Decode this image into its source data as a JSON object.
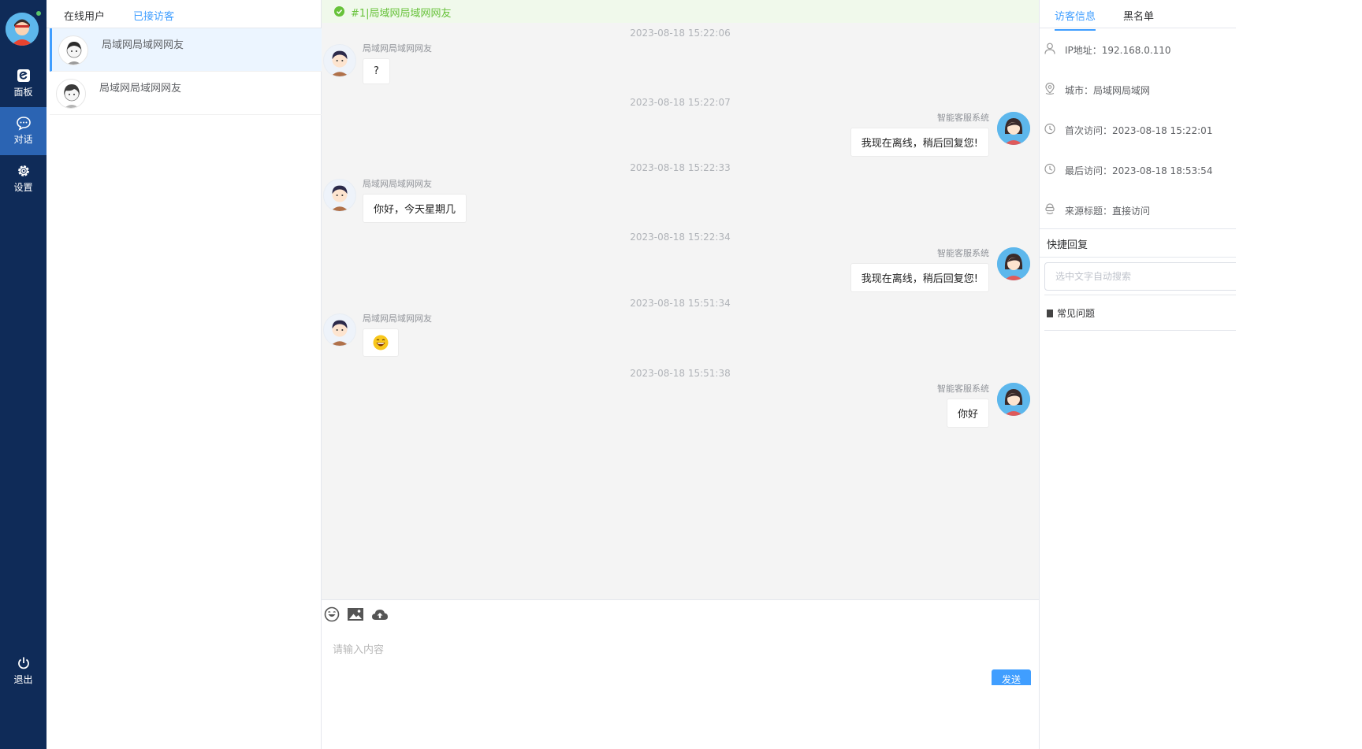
{
  "nav": {
    "items": [
      {
        "label": "面板",
        "icon": "dashboard-icon"
      },
      {
        "label": "对话",
        "icon": "chat-icon"
      },
      {
        "label": "设置",
        "icon": "gear-icon"
      }
    ],
    "logout_label": "退出",
    "active_item": "对话",
    "colors": {
      "background": "#0f2b58",
      "active": "#2b64b3",
      "online": "#5ac66a"
    }
  },
  "visitor_list": {
    "tabs": [
      {
        "label": "在线用户"
      },
      {
        "label": "已接访客"
      }
    ],
    "active_tab": "已接访客",
    "visitors": [
      {
        "name": "局域网局域网网友"
      },
      {
        "name": "局域网局域网网友"
      }
    ]
  },
  "chat": {
    "header_title": "#1|局域网局域网网友",
    "messages": [
      {
        "time": "2023-08-18 15:22:06",
        "side": "visitor",
        "sender": "局域网局域网网友",
        "text": "?"
      },
      {
        "time": "2023-08-18 15:22:07",
        "side": "agent",
        "sender": "智能客服系统",
        "text": "我现在离线，稍后回复您!"
      },
      {
        "time": "2023-08-18 15:22:33",
        "side": "visitor",
        "sender": "局域网局域网网友",
        "text": "你好，今天星期几"
      },
      {
        "time": "2023-08-18 15:22:34",
        "side": "agent",
        "sender": "智能客服系统",
        "text": "我现在离线，稍后回复您!"
      },
      {
        "time": "2023-08-18 15:51:34",
        "side": "visitor",
        "sender": "局域网局域网网友",
        "text": "",
        "emoji": "laughing-emoji"
      },
      {
        "time": "2023-08-18 15:51:38",
        "side": "agent",
        "sender": "智能客服系统",
        "text": "你好"
      }
    ],
    "composer": {
      "placeholder": "请输入内容",
      "send_label": "发送",
      "tools": [
        "emoji-icon",
        "image-icon",
        "upload-cloud-icon"
      ]
    }
  },
  "info_panel": {
    "tabs": [
      {
        "label": "访客信息"
      },
      {
        "label": "黑名单"
      }
    ],
    "active_tab": "访客信息",
    "fields": [
      {
        "icon": "user-icon",
        "text": "IP地址：192.168.0.110"
      },
      {
        "icon": "location-icon",
        "text": "城市：局域网局域网"
      },
      {
        "icon": "clock-icon",
        "text": "首次访问：2023-08-18 15:22:01"
      },
      {
        "icon": "clock-icon",
        "text": "最后访问：2023-08-18 18:53:54"
      },
      {
        "icon": "source-icon",
        "text": "来源标题：直接访问"
      }
    ],
    "quick_reply": {
      "title": "快捷回复",
      "search_placeholder": "选中文字自动搜索",
      "category": "常见问题"
    }
  }
}
